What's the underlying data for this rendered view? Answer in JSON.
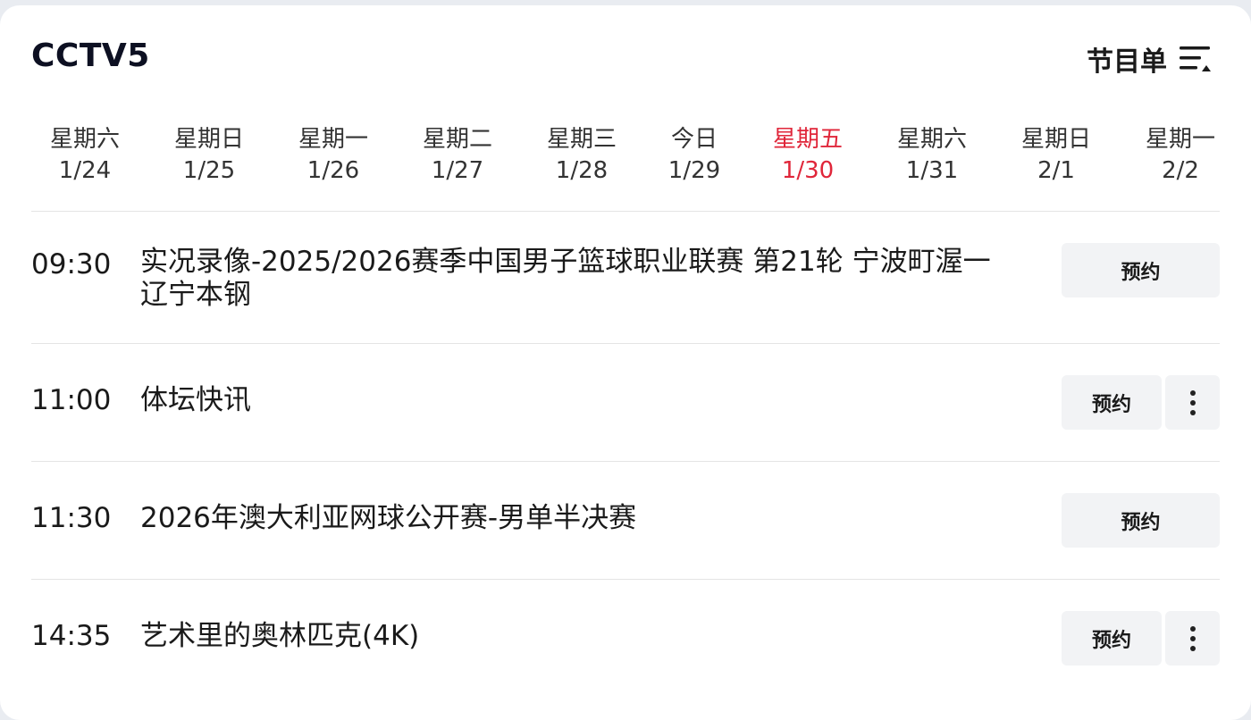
{
  "header": {
    "channel": "CCTV5",
    "schedule_label": "节目单",
    "schedule_icon": "menu-sort-icon"
  },
  "days": [
    {
      "weekday": "星期六",
      "date": "1/24",
      "active": false
    },
    {
      "weekday": "星期日",
      "date": "1/25",
      "active": false
    },
    {
      "weekday": "星期一",
      "date": "1/26",
      "active": false
    },
    {
      "weekday": "星期二",
      "date": "1/27",
      "active": false
    },
    {
      "weekday": "星期三",
      "date": "1/28",
      "active": false
    },
    {
      "weekday": "今日",
      "date": "1/29",
      "active": false
    },
    {
      "weekday": "星期五",
      "date": "1/30",
      "active": true
    },
    {
      "weekday": "星期六",
      "date": "1/31",
      "active": false
    },
    {
      "weekday": "星期日",
      "date": "2/1",
      "active": false
    },
    {
      "weekday": "星期一",
      "date": "2/2",
      "active": false
    }
  ],
  "programs": [
    {
      "time": "09:30",
      "title_line1": "实况录像-2025/2026赛季中国男子篮球职业联赛 第21轮 宁波町渥一",
      "title_line2": "辽宁本钢",
      "button": "预约",
      "has_more": false
    },
    {
      "time": "11:00",
      "title_line1": "体坛快讯",
      "button": "预约",
      "has_more": true
    },
    {
      "time": "11:30",
      "title_line1": "2026年澳大利亚网球公开赛-男单半决赛",
      "button": "预约",
      "has_more": false
    },
    {
      "time": "14:35",
      "title_line1": "艺术里的奥林匹克(4K)",
      "button": "预约",
      "has_more": true
    }
  ],
  "colors": {
    "active_day": "#e0263a",
    "text": "#1a1a1a",
    "button_bg": "#f2f3f5"
  }
}
